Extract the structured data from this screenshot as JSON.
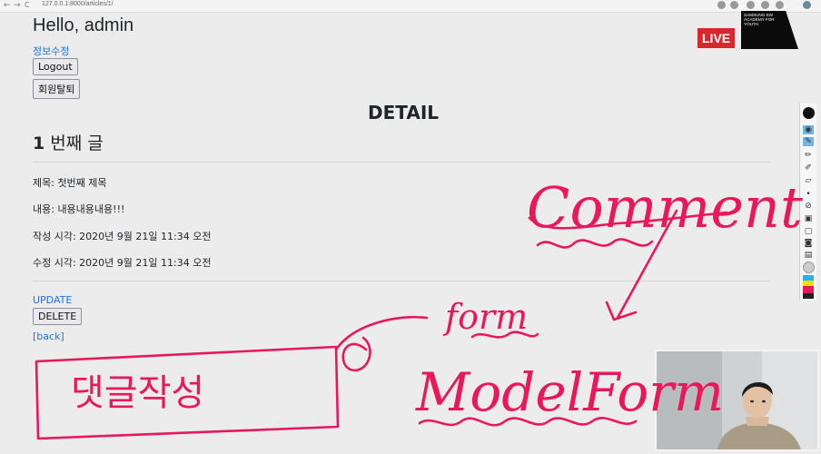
{
  "browser": {
    "url": "127.0.0.1:8000/articles/1/",
    "nav_back": "←",
    "nav_forward": "→",
    "nav_reload": "C"
  },
  "header": {
    "greeting": "Hello, admin",
    "edit_profile_link": "정보수정",
    "logout_button": "Logout",
    "withdraw_button": "회원탈퇴"
  },
  "detail": {
    "page_title": "DETAIL",
    "post_number": "1",
    "post_heading_suffix": " 번째 글",
    "fields": [
      "제목: 첫번째 제목",
      "내용: 내용내용내용!!!",
      "작성 시각: 2020년 9월 21일 11:34 오전",
      "수정 시각: 2020년 9월 21일 11:34 오전"
    ],
    "update_link": "UPDATE",
    "delete_button": "DELETE",
    "back_link": "[back]"
  },
  "overlay": {
    "live_badge": "LIVE",
    "logo_text": "SAMSUNG SW ACADEMY FOR YOUTH"
  },
  "annotations": {
    "comment": "Comment",
    "form": "form",
    "modelform": "ModelForm",
    "box_text": "댓글작성",
    "ink_color": "#e8185b"
  },
  "toolbar_tools": [
    "pointer-icon",
    "pen-icon",
    "highlighter-icon",
    "eraser-icon",
    "line-icon",
    "dot-icon",
    "shape-icon",
    "trash-icon",
    "screenshot-icon",
    "camera-icon",
    "whiteboard-icon"
  ],
  "toolbar_colors": [
    "#2ab0ea",
    "#f0e000",
    "#e8185b",
    "#222222"
  ]
}
